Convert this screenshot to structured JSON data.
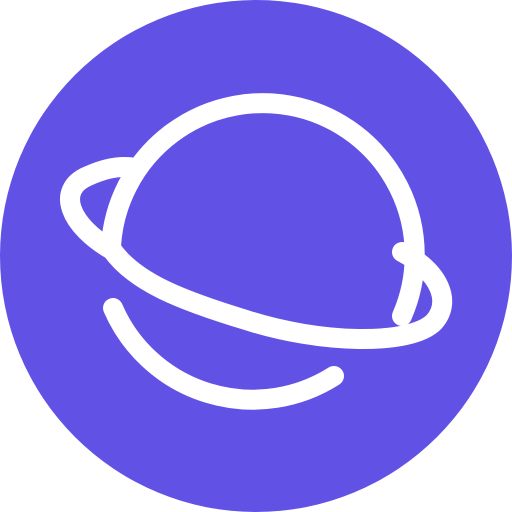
{
  "icon": {
    "name": "planet-icon",
    "colors": {
      "background": "#6152e5",
      "foreground": "#ffffff"
    }
  }
}
